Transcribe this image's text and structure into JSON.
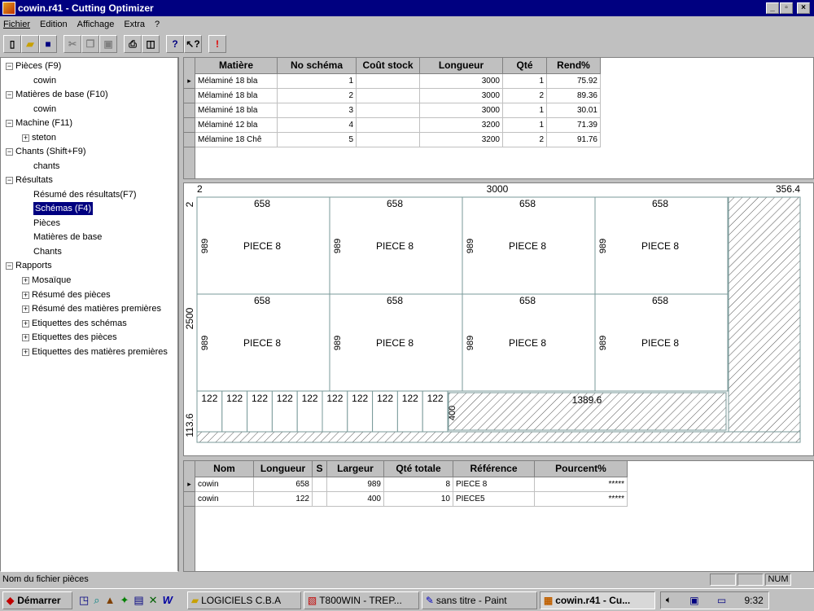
{
  "window": {
    "title": "cowin.r41 - Cutting Optimizer"
  },
  "menu": [
    "Fichier",
    "Edition",
    "Affichage",
    "Extra",
    "?"
  ],
  "toolbar_icons": [
    "new-icon",
    "open-icon",
    "save-icon",
    "cut-icon",
    "copy-icon",
    "paste-icon",
    "print-icon",
    "print-preview-icon",
    "help-icon",
    "context-help-icon",
    "alert-icon"
  ],
  "tree": {
    "pieces": "Pièces (F9)",
    "pieces_child": "cowin",
    "matieres": "Matières de base (F10)",
    "matieres_child": "cowin",
    "machine": "Machine (F11)",
    "machine_child": "steton",
    "chants": "Chants (Shift+F9)",
    "chants_child": "chants",
    "resultats": "Résultats",
    "res_resume": "Résumé des résultats(F7)",
    "res_schemas": "Schémas (F4)",
    "res_pieces": "Pièces",
    "res_matieres": "Matières de base",
    "res_chants": "Chants",
    "rapports": "Rapports",
    "rap_mosaique": "Mosaïque",
    "rap_resume_pieces": "Résumé des pièces",
    "rap_resume_mp": "Résumé des matières premières",
    "rap_etiq_schemas": "Etiquettes des schémas",
    "rap_etiq_pieces": "Etiquettes des pièces",
    "rap_etiq_mp": "Etiquettes des matières premières"
  },
  "grid1": {
    "headers": [
      "Matière",
      "No schéma",
      "Coût stock",
      "Longueur",
      "Qté",
      "Rend%"
    ],
    "rows": [
      [
        "Mélaminé 18 bla",
        "1",
        "",
        "3000",
        "1",
        "75.92"
      ],
      [
        "Mélaminé 18 bla",
        "2",
        "",
        "3000",
        "2",
        "89.36"
      ],
      [
        "Mélaminé 18 bla",
        "3",
        "",
        "3000",
        "1",
        "30.01"
      ],
      [
        "Mélaminé 12 bla",
        "4",
        "",
        "3200",
        "1",
        "71.39"
      ],
      [
        "Mélamine 18 Chê",
        "5",
        "",
        "3200",
        "2",
        "91.76"
      ]
    ]
  },
  "diagram": {
    "top_left": "2",
    "top_length": "3000",
    "top_right": "356.4",
    "left_top": "2",
    "left_height": "2500",
    "left_bottom": "113.6",
    "piece_width": "658",
    "piece_height": "989",
    "piece_label": "PIECE 8",
    "strip_width": "122",
    "strip_height": "400",
    "strip_waste": "1389.6"
  },
  "grid2": {
    "headers": [
      "Nom",
      "Longueur",
      "S",
      "Largeur",
      "Qté totale",
      "Référence",
      "Pourcent%"
    ],
    "rows": [
      [
        "cowin",
        "658",
        "",
        "989",
        "8",
        "PIECE 8",
        "*****"
      ],
      [
        "cowin",
        "122",
        "",
        "400",
        "10",
        "PIECE5",
        "*****"
      ]
    ]
  },
  "status": {
    "text": "Nom du fichier pièces",
    "num": "NUM"
  },
  "taskbar": {
    "start": "Démarrer",
    "tasks": [
      "LOGICIELS C.B.A",
      "T800WIN - TREP...",
      "sans titre - Paint",
      "cowin.r41 - Cu..."
    ],
    "clock": "9:32"
  }
}
